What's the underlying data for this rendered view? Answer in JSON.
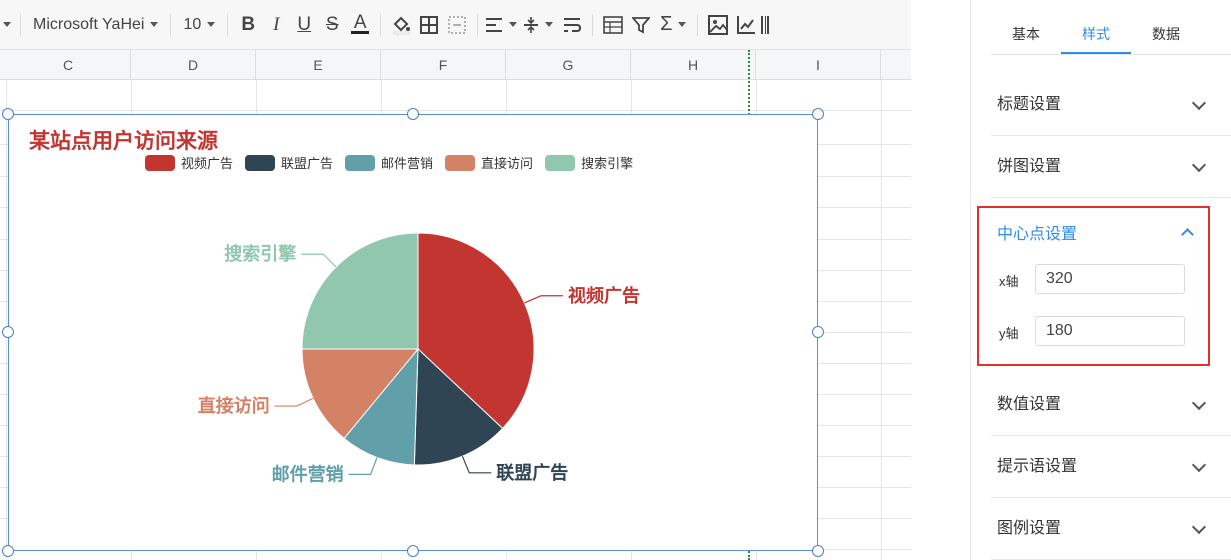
{
  "toolbar": {
    "font_family": "Microsoft YaHei",
    "font_size": "10",
    "icons": [
      "dropdown-caret",
      "bold-icon",
      "italic-icon",
      "underline-icon",
      "strikethrough-icon",
      "font-color-icon",
      "fill-color-icon",
      "borders-icon",
      "merge-cells-icon",
      "align-icon",
      "vertical-align-icon",
      "wrap-text-icon",
      "table-icon",
      "filter-icon",
      "sum-icon",
      "image-icon",
      "chart-icon"
    ]
  },
  "grid": {
    "columns": [
      "C",
      "D",
      "E",
      "F",
      "G",
      "H",
      "I"
    ]
  },
  "chart": {
    "title": "某站点用户访问来源",
    "colors": {
      "title": "#c23531"
    }
  },
  "chart_data": {
    "type": "pie",
    "title": "某站点用户访问来源",
    "labels": [
      "视频广告",
      "联盟广告",
      "邮件营销",
      "直接访问",
      "搜索引擎"
    ],
    "values": [
      37,
      13.5,
      10.5,
      14,
      25
    ],
    "colors": [
      "#c23531",
      "#2f4554",
      "#61a0a8",
      "#d48265",
      "#91c7ae"
    ],
    "legend": "top-center"
  },
  "panel": {
    "tabs": [
      "基本",
      "样式",
      "数据"
    ],
    "active_tab": "样式",
    "sections": {
      "title_settings": "标题设置",
      "pie_settings": "饼图设置",
      "center_settings": "中心点设置",
      "value_settings": "数值设置",
      "tooltip_settings": "提示语设置",
      "legend_settings": "图例设置"
    },
    "center": {
      "x_label": "x轴",
      "x_value": "320",
      "y_label": "y轴",
      "y_value": "180"
    },
    "accent_color": "#2d8cf0",
    "highlight_color": "#e0312f"
  }
}
